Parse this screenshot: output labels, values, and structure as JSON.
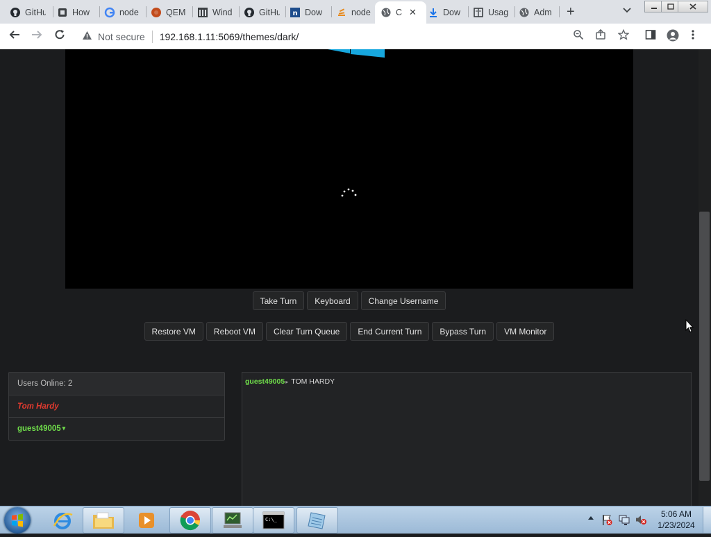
{
  "browser": {
    "tabs": [
      {
        "label": "GitHu",
        "icon": "github-icon"
      },
      {
        "label": "How",
        "icon": "site-icon"
      },
      {
        "label": "node",
        "icon": "google-icon"
      },
      {
        "label": "QEM",
        "icon": "qemu-icon"
      },
      {
        "label": "Wind",
        "icon": "columns-icon"
      },
      {
        "label": "GitHu",
        "icon": "github-icon"
      },
      {
        "label": "Dow",
        "icon": "n-icon"
      },
      {
        "label": "node",
        "icon": "stack-icon"
      },
      {
        "label": "C",
        "icon": "globe-icon",
        "active": true
      },
      {
        "label": "Dow",
        "icon": "download-icon"
      },
      {
        "label": "Usag",
        "icon": "doc-icon"
      },
      {
        "label": "Adm",
        "icon": "globe-icon"
      }
    ],
    "new_tab": "+",
    "tab_menu": "⌄",
    "security": "Not secure",
    "url": "192.168.1.11:5069/themes/dark/"
  },
  "vm": {
    "primary_buttons": [
      "Take Turn",
      "Keyboard",
      "Change Username"
    ],
    "admin_buttons": [
      "Restore VM",
      "Reboot VM",
      "Clear Turn Queue",
      "End Current Turn",
      "Bypass Turn",
      "VM Monitor"
    ]
  },
  "users": {
    "header": "Users Online: 2",
    "list": [
      {
        "name": "Tom Hardy"
      },
      {
        "name": "guest49005",
        "suffix": "▾"
      }
    ]
  },
  "chat": {
    "messages": [
      {
        "user": "guest49005",
        "arrow": "▸",
        "text": "TOM HARDY"
      }
    ]
  },
  "taskbar": {
    "time": "5:06 AM",
    "date": "1/23/2024"
  },
  "colors": {
    "user_admin": "#e03a2f",
    "user_guest": "#6fdc4a",
    "page_bg": "#1b1c1e"
  }
}
